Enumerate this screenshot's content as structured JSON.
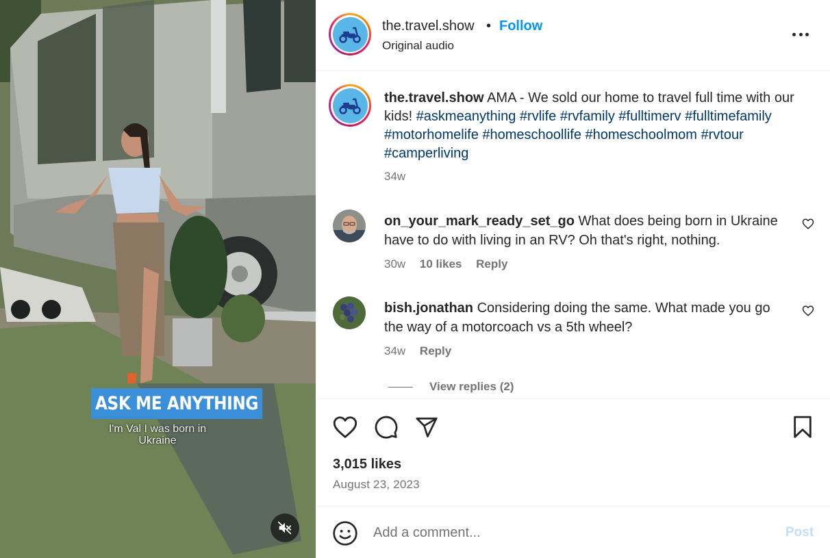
{
  "media": {
    "caption_title": "ASK ME ANYTHING",
    "caption_subtitle": "I'm Val I was born in Ukraine",
    "mute_icon": "speaker-muted-icon"
  },
  "header": {
    "username": "the.travel.show",
    "separator": "•",
    "follow_label": "Follow",
    "audio_label": "Original audio",
    "more_icon": "more-horizontal-icon"
  },
  "caption": {
    "username": "the.travel.show",
    "text": "AMA - We sold our home to travel full time with our kids!",
    "hashtags": [
      "#askmeanything",
      "#rvlife",
      "#rvfamily",
      "#fulltimerv",
      "#fulltimefamily",
      "#motorhomelife",
      "#homeschoollife",
      "#homeschoolmom",
      "#rvtour",
      "#camperliving"
    ],
    "time": "34w"
  },
  "comments": [
    {
      "username": "on_your_mark_ready_set_go",
      "text": "What does being born in Ukraine have to do with living in an RV? Oh that's right, nothing.",
      "time": "30w",
      "likes": "10 likes",
      "reply_label": "Reply"
    },
    {
      "username": "bish.jonathan",
      "text": "Considering doing the same. What made you go the way of a motorcoach vs a 5th wheel?",
      "time": "34w",
      "reply_label": "Reply",
      "view_replies": "View replies (2)"
    }
  ],
  "actions": {
    "like_icon": "heart-icon",
    "comment_icon": "comment-bubble-icon",
    "share_icon": "paper-plane-icon",
    "save_icon": "bookmark-icon",
    "likes_count": "3,015 likes",
    "date": "August 23, 2023"
  },
  "add_comment": {
    "emoji_icon": "smiley-icon",
    "placeholder": "Add a comment...",
    "post_label": "Post"
  },
  "colors": {
    "follow_blue": "#0095f6",
    "hashtag_blue": "#00376b",
    "secondary_text": "#737373",
    "caption_bg": "#3b8ed8"
  }
}
